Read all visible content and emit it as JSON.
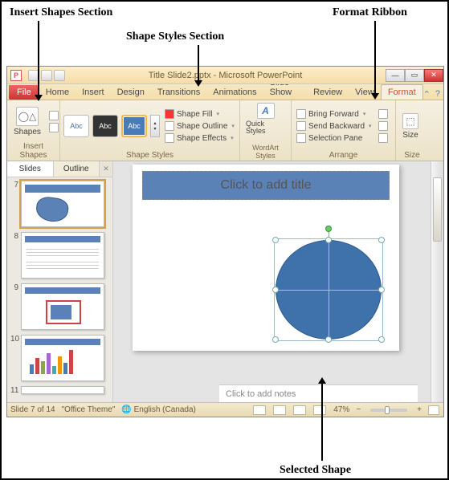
{
  "annotations": {
    "insert_shapes": "Insert Shapes Section",
    "shape_styles": "Shape Styles Section",
    "format_ribbon": "Format Ribbon",
    "selected_shape": "Selected Shape"
  },
  "titlebar": {
    "title": "Title Slide2.pptx - Microsoft PowerPoint",
    "app_letter": "P"
  },
  "tabs": {
    "file": "File",
    "home": "Home",
    "insert": "Insert",
    "design": "Design",
    "transitions": "Transitions",
    "animations": "Animations",
    "slide_show": "Slide Show",
    "review": "Review",
    "view": "View",
    "format": "Format"
  },
  "ribbon": {
    "insert_shapes": {
      "shapes": "Shapes",
      "group_label": "Insert Shapes"
    },
    "shape_styles": {
      "abc": "Abc",
      "shape_fill": "Shape Fill",
      "shape_outline": "Shape Outline",
      "shape_effects": "Shape Effects",
      "group_label": "Shape Styles"
    },
    "wordart": {
      "quick_styles": "Quick Styles",
      "group_label": "WordArt Styles"
    },
    "arrange": {
      "bring_forward": "Bring Forward",
      "send_backward": "Send Backward",
      "selection_pane": "Selection Pane",
      "group_label": "Arrange"
    },
    "size": {
      "size": "Size",
      "group_label": "Size"
    }
  },
  "sidepanel": {
    "tab_slides": "Slides",
    "tab_outline": "Outline",
    "thumbs": [
      "7",
      "8",
      "9",
      "10",
      "11"
    ]
  },
  "slide": {
    "title_placeholder": "Click to add title"
  },
  "notes": {
    "placeholder": "Click to add notes"
  },
  "status": {
    "slide_of": "Slide 7 of 14",
    "theme": "\"Office Theme\"",
    "lang": "English (Canada)",
    "zoom": "47%"
  }
}
